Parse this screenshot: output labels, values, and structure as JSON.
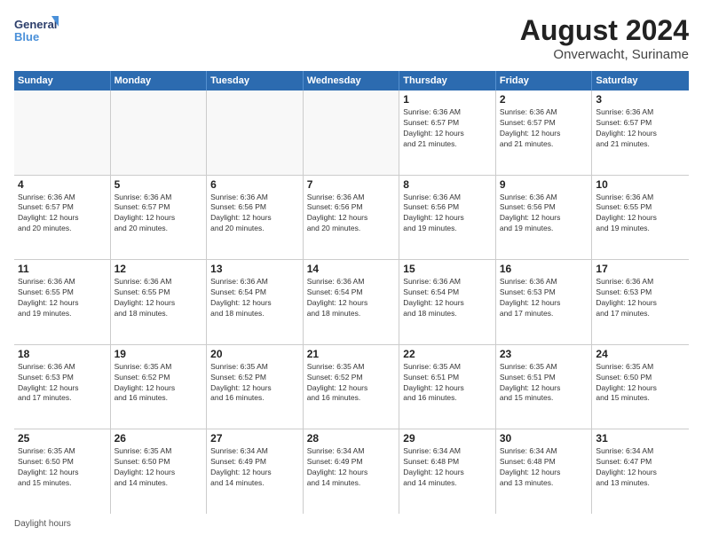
{
  "header": {
    "logo": {
      "text_general": "General",
      "text_blue": "Blue"
    },
    "title": "August 2024",
    "subtitle": "Onverwacht, Suriname"
  },
  "calendar": {
    "days_of_week": [
      "Sunday",
      "Monday",
      "Tuesday",
      "Wednesday",
      "Thursday",
      "Friday",
      "Saturday"
    ],
    "footer_text": "Daylight hours",
    "rows": [
      [
        {
          "day": "",
          "info": ""
        },
        {
          "day": "",
          "info": ""
        },
        {
          "day": "",
          "info": ""
        },
        {
          "day": "",
          "info": ""
        },
        {
          "day": "1",
          "info": "Sunrise: 6:36 AM\nSunset: 6:57 PM\nDaylight: 12 hours\nand 21 minutes."
        },
        {
          "day": "2",
          "info": "Sunrise: 6:36 AM\nSunset: 6:57 PM\nDaylight: 12 hours\nand 21 minutes."
        },
        {
          "day": "3",
          "info": "Sunrise: 6:36 AM\nSunset: 6:57 PM\nDaylight: 12 hours\nand 21 minutes."
        }
      ],
      [
        {
          "day": "4",
          "info": "Sunrise: 6:36 AM\nSunset: 6:57 PM\nDaylight: 12 hours\nand 20 minutes."
        },
        {
          "day": "5",
          "info": "Sunrise: 6:36 AM\nSunset: 6:57 PM\nDaylight: 12 hours\nand 20 minutes."
        },
        {
          "day": "6",
          "info": "Sunrise: 6:36 AM\nSunset: 6:56 PM\nDaylight: 12 hours\nand 20 minutes."
        },
        {
          "day": "7",
          "info": "Sunrise: 6:36 AM\nSunset: 6:56 PM\nDaylight: 12 hours\nand 20 minutes."
        },
        {
          "day": "8",
          "info": "Sunrise: 6:36 AM\nSunset: 6:56 PM\nDaylight: 12 hours\nand 19 minutes."
        },
        {
          "day": "9",
          "info": "Sunrise: 6:36 AM\nSunset: 6:56 PM\nDaylight: 12 hours\nand 19 minutes."
        },
        {
          "day": "10",
          "info": "Sunrise: 6:36 AM\nSunset: 6:55 PM\nDaylight: 12 hours\nand 19 minutes."
        }
      ],
      [
        {
          "day": "11",
          "info": "Sunrise: 6:36 AM\nSunset: 6:55 PM\nDaylight: 12 hours\nand 19 minutes."
        },
        {
          "day": "12",
          "info": "Sunrise: 6:36 AM\nSunset: 6:55 PM\nDaylight: 12 hours\nand 18 minutes."
        },
        {
          "day": "13",
          "info": "Sunrise: 6:36 AM\nSunset: 6:54 PM\nDaylight: 12 hours\nand 18 minutes."
        },
        {
          "day": "14",
          "info": "Sunrise: 6:36 AM\nSunset: 6:54 PM\nDaylight: 12 hours\nand 18 minutes."
        },
        {
          "day": "15",
          "info": "Sunrise: 6:36 AM\nSunset: 6:54 PM\nDaylight: 12 hours\nand 18 minutes."
        },
        {
          "day": "16",
          "info": "Sunrise: 6:36 AM\nSunset: 6:53 PM\nDaylight: 12 hours\nand 17 minutes."
        },
        {
          "day": "17",
          "info": "Sunrise: 6:36 AM\nSunset: 6:53 PM\nDaylight: 12 hours\nand 17 minutes."
        }
      ],
      [
        {
          "day": "18",
          "info": "Sunrise: 6:36 AM\nSunset: 6:53 PM\nDaylight: 12 hours\nand 17 minutes."
        },
        {
          "day": "19",
          "info": "Sunrise: 6:35 AM\nSunset: 6:52 PM\nDaylight: 12 hours\nand 16 minutes."
        },
        {
          "day": "20",
          "info": "Sunrise: 6:35 AM\nSunset: 6:52 PM\nDaylight: 12 hours\nand 16 minutes."
        },
        {
          "day": "21",
          "info": "Sunrise: 6:35 AM\nSunset: 6:52 PM\nDaylight: 12 hours\nand 16 minutes."
        },
        {
          "day": "22",
          "info": "Sunrise: 6:35 AM\nSunset: 6:51 PM\nDaylight: 12 hours\nand 16 minutes."
        },
        {
          "day": "23",
          "info": "Sunrise: 6:35 AM\nSunset: 6:51 PM\nDaylight: 12 hours\nand 15 minutes."
        },
        {
          "day": "24",
          "info": "Sunrise: 6:35 AM\nSunset: 6:50 PM\nDaylight: 12 hours\nand 15 minutes."
        }
      ],
      [
        {
          "day": "25",
          "info": "Sunrise: 6:35 AM\nSunset: 6:50 PM\nDaylight: 12 hours\nand 15 minutes."
        },
        {
          "day": "26",
          "info": "Sunrise: 6:35 AM\nSunset: 6:50 PM\nDaylight: 12 hours\nand 14 minutes."
        },
        {
          "day": "27",
          "info": "Sunrise: 6:34 AM\nSunset: 6:49 PM\nDaylight: 12 hours\nand 14 minutes."
        },
        {
          "day": "28",
          "info": "Sunrise: 6:34 AM\nSunset: 6:49 PM\nDaylight: 12 hours\nand 14 minutes."
        },
        {
          "day": "29",
          "info": "Sunrise: 6:34 AM\nSunset: 6:48 PM\nDaylight: 12 hours\nand 14 minutes."
        },
        {
          "day": "30",
          "info": "Sunrise: 6:34 AM\nSunset: 6:48 PM\nDaylight: 12 hours\nand 13 minutes."
        },
        {
          "day": "31",
          "info": "Sunrise: 6:34 AM\nSunset: 6:47 PM\nDaylight: 12 hours\nand 13 minutes."
        }
      ]
    ]
  }
}
